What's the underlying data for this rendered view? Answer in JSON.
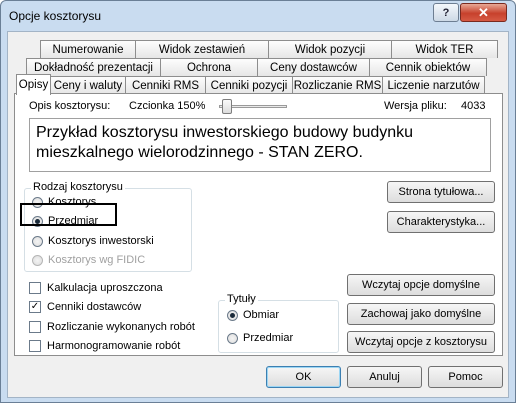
{
  "window": {
    "title": "Opcje kosztorysu",
    "help_label": "?",
    "close_label": "✕"
  },
  "tabs": {
    "row1": [
      "Numerowanie",
      "Widok zestawień",
      "Widok pozycji",
      "Widok TER"
    ],
    "row2": [
      "Dokładność prezentacji",
      "Ochrona",
      "Ceny dostawców",
      "Cennik obiektów"
    ],
    "row3": [
      "Opisy",
      "Ceny i waluty",
      "Cenniki RMS",
      "Cenniki pozycji",
      "Rozliczanie RMS",
      "Liczenie narzutów"
    ],
    "active": "Opisy"
  },
  "panel": {
    "desc_label": "Opis kosztorysu:",
    "font_label": "Czcionka 150%",
    "version_label": "Wersja pliku:",
    "version_value": "4033",
    "description_text": "Przykład kosztorysu inwestorskiego budowy budynku mieszkalnego wielorodzinnego - STAN ZERO.",
    "rodzaj": {
      "title": "Rodzaj kosztorysu",
      "options": [
        "Kosztorys",
        "Przedmiar",
        "Kosztorys inwestorski",
        "Kosztorys wg FIDIC"
      ],
      "selected": "Przedmiar"
    },
    "checkboxes": [
      {
        "label": "Kalkulacja uproszczona",
        "checked": false
      },
      {
        "label": "Cenniki dostawców",
        "checked": true
      },
      {
        "label": "Rozliczanie wykonanych robót",
        "checked": false
      },
      {
        "label": "Harmonogramowanie robót",
        "checked": false
      }
    ],
    "tytuly": {
      "title": "Tytuły",
      "options": [
        "Obmiar",
        "Przedmiar"
      ],
      "selected": "Obmiar"
    },
    "buttons": {
      "strona": "Strona tytułowa...",
      "charakterystyka": "Charakterystyka...",
      "wczytaj_domyslne": "Wczytaj opcje domyślne",
      "zachowaj": "Zachowaj jako domyślne",
      "wczytaj_kosztorys": "Wczytaj opcje z kosztorysu"
    }
  },
  "footer": {
    "ok": "OK",
    "anuluj": "Anuluj",
    "pomoc": "Pomoc"
  }
}
